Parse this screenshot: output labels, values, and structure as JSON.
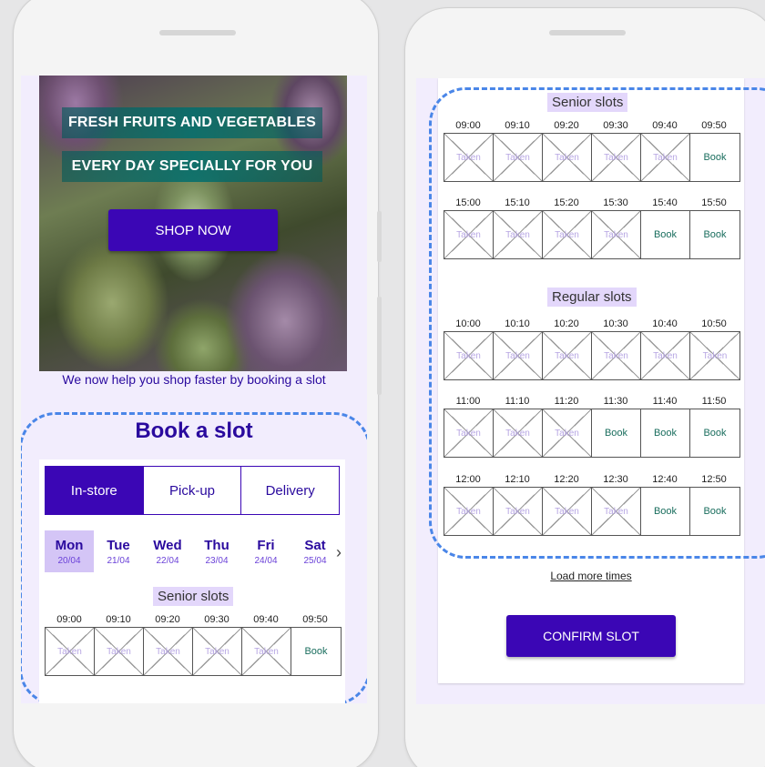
{
  "hero": {
    "line1": "FRESH FRUITS AND VEGETABLES",
    "line2": "EVERY DAY SPECIALLY FOR YOU",
    "cta": "SHOP NOW"
  },
  "tagline": "We now help you shop faster by booking a slot",
  "booking_title": "Book a slot",
  "tabs": [
    "In-store",
    "Pick-up",
    "Delivery"
  ],
  "active_tab": "In-store",
  "days": [
    {
      "name": "Mon",
      "date": "20/04"
    },
    {
      "name": "Tue",
      "date": "21/04"
    },
    {
      "name": "Wed",
      "date": "22/04"
    },
    {
      "name": "Thu",
      "date": "23/04"
    },
    {
      "name": "Fri",
      "date": "24/04"
    },
    {
      "name": "Sat",
      "date": "25/04"
    }
  ],
  "active_day": "Mon",
  "chevron": "›",
  "labels": {
    "taken": "Taken",
    "book": "Book"
  },
  "left_screen": {
    "senior_title": "Senior slots",
    "senior_row": {
      "times": [
        "09:00",
        "09:10",
        "09:20",
        "09:30",
        "09:40",
        "09:50"
      ],
      "status": [
        "Taken",
        "Taken",
        "Taken",
        "Taken",
        "Taken",
        "Book"
      ]
    }
  },
  "right_screen": {
    "senior_title": "Senior slots",
    "senior_rows": [
      {
        "times": [
          "09:00",
          "09:10",
          "09:20",
          "09:30",
          "09:40",
          "09:50"
        ],
        "status": [
          "Taken",
          "Taken",
          "Taken",
          "Taken",
          "Taken",
          "Book"
        ]
      },
      {
        "times": [
          "15:00",
          "15:10",
          "15:20",
          "15:30",
          "15:40",
          "15:50"
        ],
        "status": [
          "Taken",
          "Taken",
          "Taken",
          "Taken",
          "Book",
          "Book"
        ]
      }
    ],
    "regular_title": "Regular slots",
    "regular_rows": [
      {
        "times": [
          "10:00",
          "10:10",
          "10:20",
          "10:30",
          "10:40",
          "10:50"
        ],
        "status": [
          "Taken",
          "Taken",
          "Taken",
          "Taken",
          "Taken",
          "Taken"
        ]
      },
      {
        "times": [
          "11:00",
          "11:10",
          "11:20",
          "11:30",
          "11:40",
          "11:50"
        ],
        "status": [
          "Taken",
          "Taken",
          "Taken",
          "Book",
          "Book",
          "Book"
        ]
      },
      {
        "times": [
          "12:00",
          "12:10",
          "12:20",
          "12:30",
          "12:40",
          "12:50"
        ],
        "status": [
          "Taken",
          "Taken",
          "Taken",
          "Taken",
          "Book",
          "Book"
        ]
      }
    ],
    "load_more": "Load more times",
    "confirm": "CONFIRM SLOT"
  },
  "colors": {
    "primary": "#3b06b5",
    "accent_light": "#d4c5f6",
    "dash": "#4a86e8",
    "book_text": "#1a6e5e"
  }
}
